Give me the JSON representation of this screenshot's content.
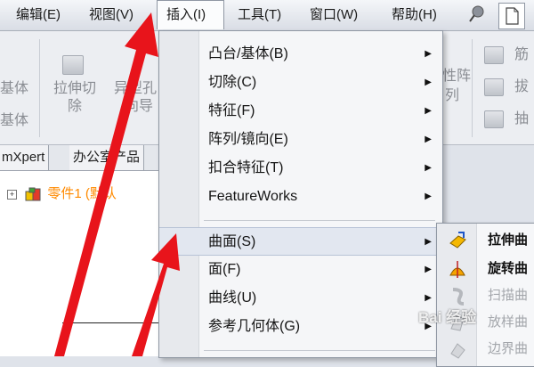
{
  "menubar": {
    "items": [
      "编辑(E)",
      "视图(V)",
      "插入(I)",
      "工具(T)",
      "窗口(W)",
      "帮助(H)"
    ],
    "active_index": 2
  },
  "toolbar": {
    "left_labels": [
      "基体",
      "基体"
    ],
    "extrude_cut": [
      "拉伸切",
      "除"
    ],
    "center_partial": [
      "异型孔",
      "向导"
    ],
    "linear_pattern": [
      "性阵",
      "列"
    ],
    "right_labels": [
      "筋",
      "拔",
      "抽"
    ]
  },
  "tabs": [
    "mXpert",
    "办公室产品"
  ],
  "tree": {
    "root_label": "零件1 (默认"
  },
  "insert_menu": {
    "items": [
      {
        "label": "凸台/基体(B)",
        "has_submenu": true
      },
      {
        "label": "切除(C)",
        "has_submenu": true
      },
      {
        "label": "特征(F)",
        "has_submenu": true
      },
      {
        "label": "阵列/镜向(E)",
        "has_submenu": true
      },
      {
        "label": "扣合特征(T)",
        "has_submenu": true
      },
      {
        "label": "FeatureWorks",
        "has_submenu": true
      },
      {
        "label": "曲面(S)",
        "has_submenu": true,
        "highlighted": true
      },
      {
        "label": "面(F)",
        "has_submenu": true
      },
      {
        "label": "曲线(U)",
        "has_submenu": true
      },
      {
        "label": "参考几何体(G)",
        "has_submenu": true
      }
    ]
  },
  "surface_submenu": {
    "items": [
      {
        "label": "拉伸曲",
        "enabled": true,
        "icon": "extrude-surface-icon"
      },
      {
        "label": "旋转曲",
        "enabled": true,
        "icon": "revolve-surface-icon"
      },
      {
        "label": "扫描曲",
        "enabled": false,
        "icon": "sweep-surface-icon"
      },
      {
        "label": "放样曲",
        "enabled": false,
        "icon": "loft-surface-icon"
      },
      {
        "label": "边界曲",
        "enabled": false,
        "icon": "boundary-surface-icon"
      }
    ]
  },
  "watermark": "Bai 经验",
  "colors": {
    "arrow": "#e8141b",
    "tree_text": "#ff8a00",
    "menu_highlight": "#e2e7f0"
  }
}
